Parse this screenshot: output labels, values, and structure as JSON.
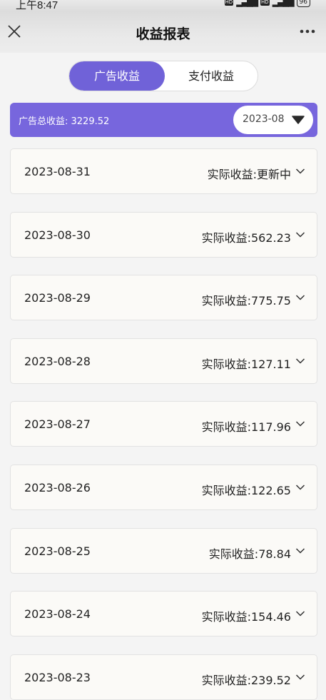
{
  "status_bar": {
    "time": "上午8:47",
    "battery": "96"
  },
  "header": {
    "title": "收益报表"
  },
  "tabs": [
    {
      "label": "广告收益",
      "active": true
    },
    {
      "label": "支付收益",
      "active": false
    }
  ],
  "summary": {
    "label": "广告总收益: 3229.52",
    "month": "2023-08"
  },
  "rows": [
    {
      "date": "2023-08-31",
      "income": "实际收益:更新中"
    },
    {
      "date": "2023-08-30",
      "income": "实际收益:562.23"
    },
    {
      "date": "2023-08-29",
      "income": "实际收益:775.75"
    },
    {
      "date": "2023-08-28",
      "income": "实际收益:127.11"
    },
    {
      "date": "2023-08-27",
      "income": "实际收益:117.96"
    },
    {
      "date": "2023-08-26",
      "income": "实际收益:122.65"
    },
    {
      "date": "2023-08-25",
      "income": "实际收益:78.84"
    },
    {
      "date": "2023-08-24",
      "income": "实际收益:154.46"
    },
    {
      "date": "2023-08-23",
      "income": "实际收益:239.52"
    }
  ],
  "colors": {
    "accent": "#7062d8",
    "summary_bg": "#7766dd",
    "row_bg": "#fbfaf7"
  }
}
